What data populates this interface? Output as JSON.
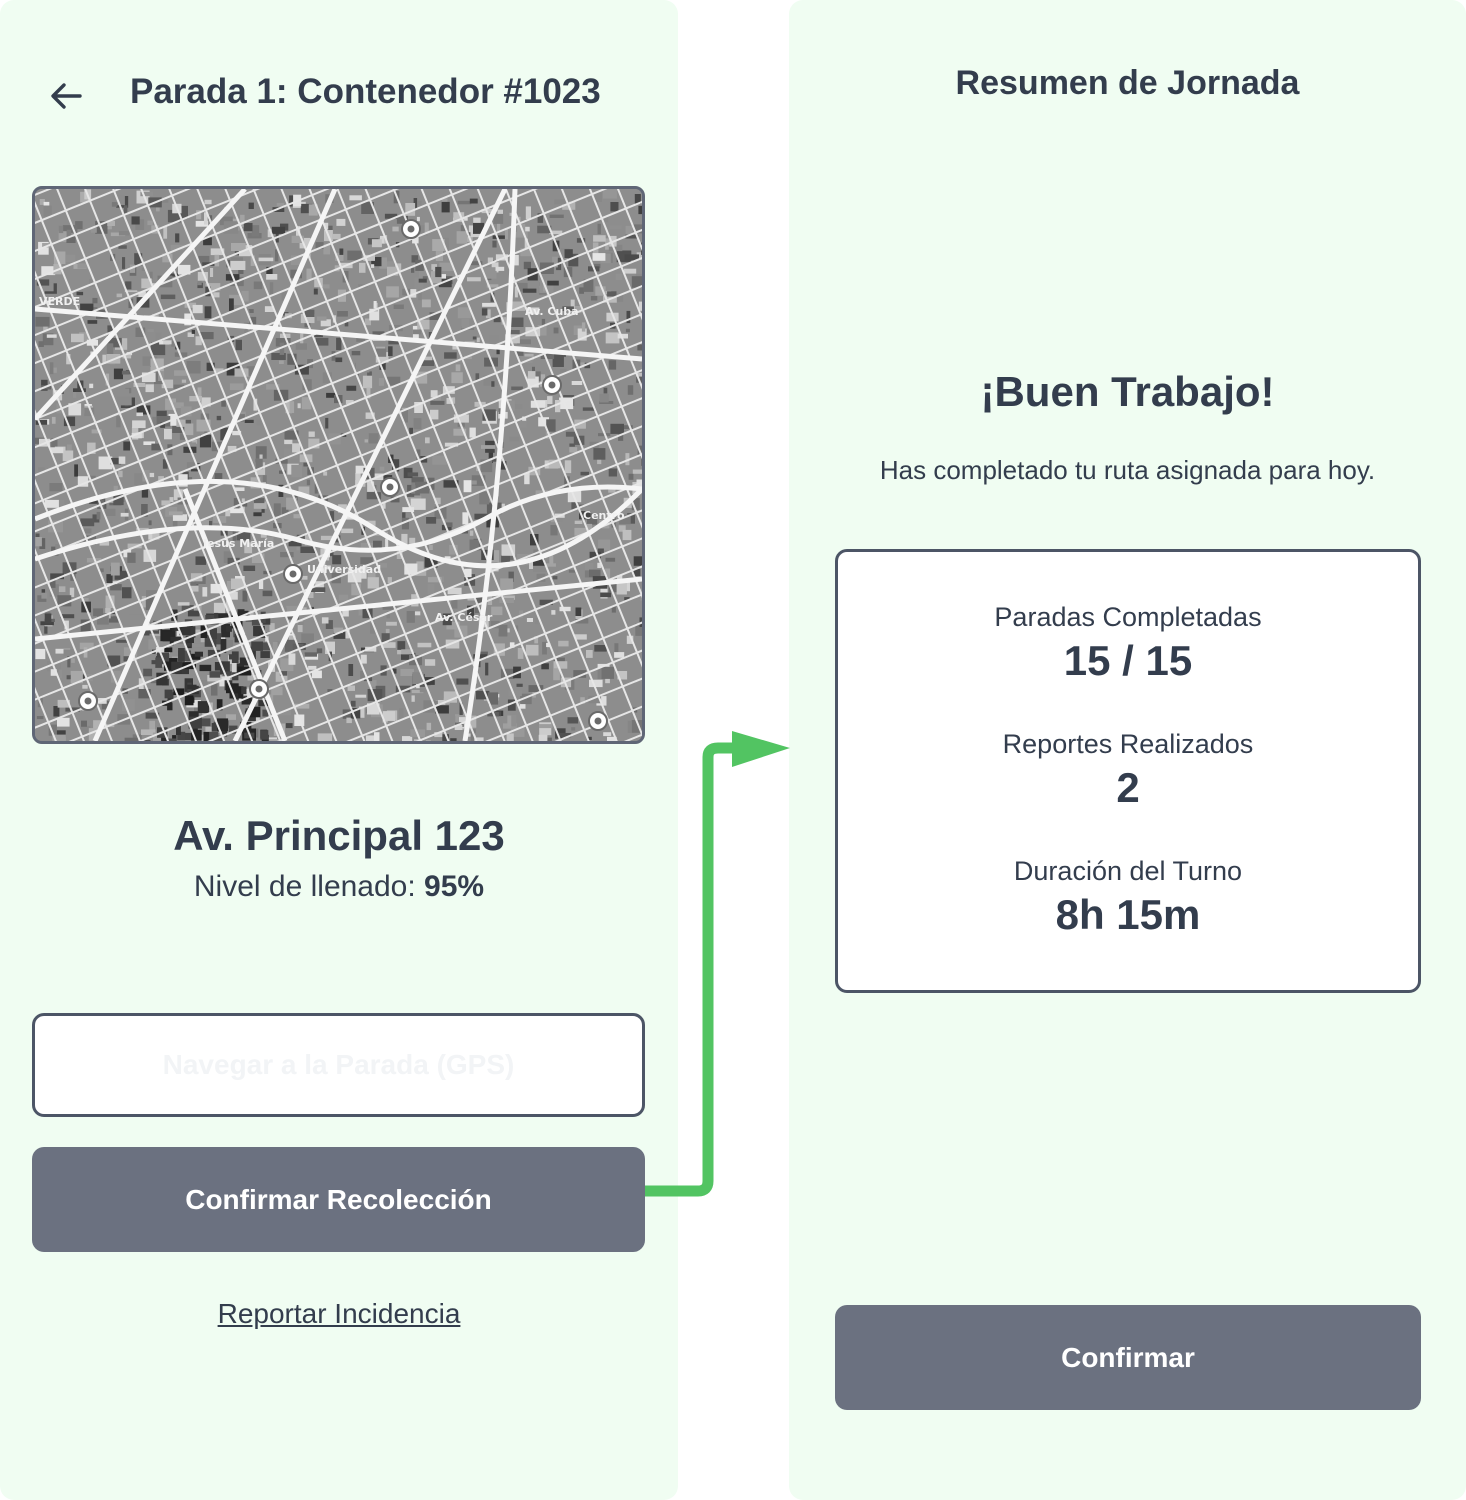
{
  "left_screen": {
    "title": "Parada 1: Contenedor #1023",
    "map": {
      "labels": [
        "VERDE",
        "Av. Cuba",
        "Jesús María",
        "Universidad",
        "Av. César",
        "Centro"
      ]
    },
    "address": "Av. Principal 123",
    "fill_level_label": "Nivel de llenado:",
    "fill_level_value": "95%",
    "navigate_button": "Navegar a la Parada (GPS)",
    "confirm_collection_button": "Confirmar Recolección",
    "report_link": "Reportar Incidencia"
  },
  "right_screen": {
    "title": "Resumen de Jornada",
    "success_heading": "¡Buen Trabajo!",
    "success_message": "Has completado tu ruta asignada para hoy.",
    "stats": [
      {
        "label": "Paradas Completadas",
        "value": "15 / 15"
      },
      {
        "label": "Reportes Realizados",
        "value": "2"
      },
      {
        "label": "Duración del Turno",
        "value": "8h 15m"
      }
    ],
    "confirm_button": "Confirmar"
  },
  "colors": {
    "screen_bg": "#f0fdf2",
    "text": "#333d4d",
    "button_solid": "#6b7180",
    "flow_arrow": "#52c462"
  },
  "icons": {
    "back": "arrow-left-icon",
    "map_pin": "map-pin-icon",
    "flow": "flow-arrow-icon"
  }
}
